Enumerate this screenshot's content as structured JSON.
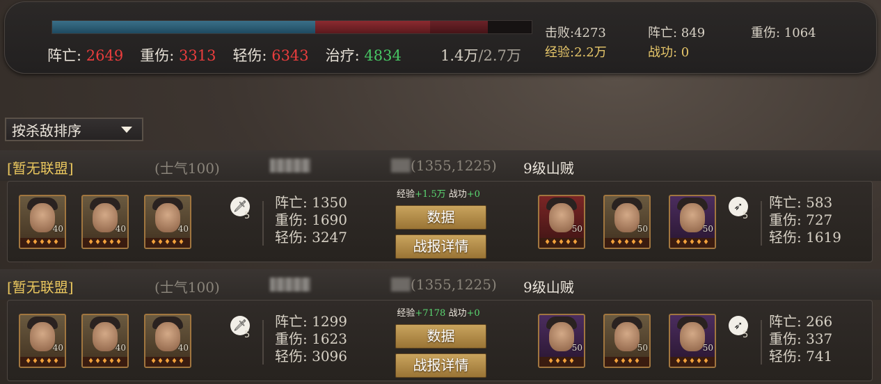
{
  "summary": {
    "progress": {
      "blue_fraction": 0.548,
      "red_fraction": 0.24,
      "red2_fraction": 0.12
    },
    "dead_label": "阵亡:",
    "dead_value": "2649",
    "heavy_label": "重伤:",
    "heavy_value": "3313",
    "light_label": "轻伤:",
    "light_value": "6343",
    "heal_label": "治疗:",
    "heal_value": "4834",
    "troops_current": "1.4万",
    "troops_sep": "/",
    "troops_total": "2.7万"
  },
  "right_stats": {
    "kills": "击败:4273",
    "dead": "阵亡: 849",
    "heavy": "重伤: 1064",
    "exp": "经验:2.2万",
    "merit": "战功: 0"
  },
  "sort": {
    "label": "按杀敌排序"
  },
  "battles": [
    {
      "alliance": "[暂无联盟]",
      "morale": "(士气100)",
      "coord": "(1355,1225)",
      "enemy": "9级山贼",
      "reward_exp_label": "经验",
      "reward_exp_value": "+1.5万",
      "reward_merit_label": "战功",
      "reward_merit_value": "+0",
      "btn_data": "数据",
      "btn_report": "战报详情",
      "ally_heroes": [
        {
          "level": "40",
          "stars": "♦♦♦♦♦"
        },
        {
          "level": "40",
          "stars": "♦♦♦♦♦"
        },
        {
          "level": "40",
          "stars": "♦♦♦♦♦"
        }
      ],
      "enemy_heroes": [
        {
          "level": "50",
          "stars": "♦♦♦♦♦"
        },
        {
          "level": "50",
          "stars": "♦♦♦♦♦"
        },
        {
          "level": "50",
          "stars": "♦♦♦♦♦"
        }
      ],
      "ally_troop_icon": "sword-icon",
      "ally_troop_count": "5",
      "enemy_troop_icon": "spear-icon",
      "enemy_troop_count": "5",
      "ally_casualties": {
        "dead": "阵亡: 1350",
        "heavy": "重伤: 1690",
        "light": "轻伤: 3247"
      },
      "enemy_casualties": {
        "dead": "阵亡: 583",
        "heavy": "重伤: 727",
        "light": "轻伤: 1619"
      }
    },
    {
      "alliance": "[暂无联盟]",
      "morale": "(士气100)",
      "coord": "(1355,1225)",
      "enemy": "9级山贼",
      "reward_exp_label": "经验",
      "reward_exp_value": "+7178",
      "reward_merit_label": "战功",
      "reward_merit_value": "+0",
      "btn_data": "数据",
      "btn_report": "战报详情",
      "ally_heroes": [
        {
          "level": "40",
          "stars": "♦♦♦♦♦"
        },
        {
          "level": "40",
          "stars": "♦♦♦♦♦"
        },
        {
          "level": "40",
          "stars": "♦♦♦♦♦"
        }
      ],
      "enemy_heroes": [
        {
          "level": "50",
          "stars": "♦♦♦♦"
        },
        {
          "level": "50",
          "stars": "♦♦♦♦"
        },
        {
          "level": "50",
          "stars": "♦♦♦♦♦"
        }
      ],
      "ally_troop_icon": "sword-icon",
      "ally_troop_count": "5",
      "enemy_troop_icon": "spear-icon",
      "enemy_troop_count": "5",
      "ally_casualties": {
        "dead": "阵亡: 1299",
        "heavy": "重伤: 1623",
        "light": "轻伤: 3096"
      },
      "enemy_casualties": {
        "dead": "阵亡: 266",
        "heavy": "重伤: 337",
        "light": "轻伤: 741"
      }
    }
  ]
}
